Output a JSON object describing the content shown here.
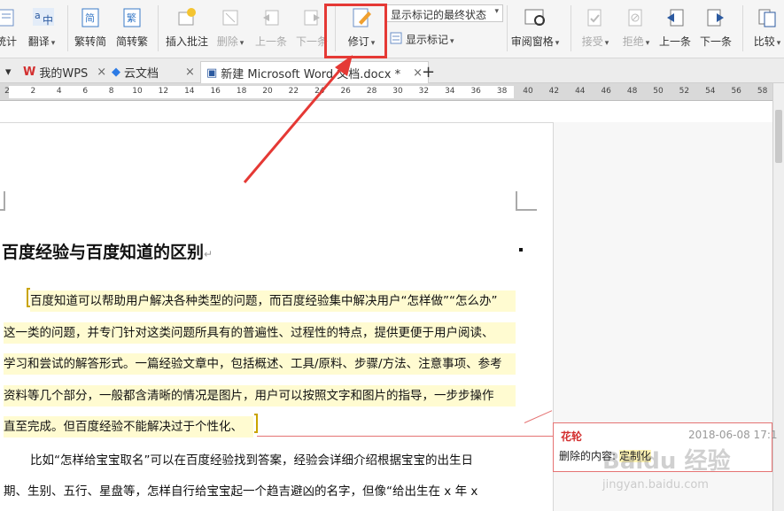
{
  "toolbar": {
    "buttons": [
      {
        "label": "统计",
        "icon": "word-count-icon"
      },
      {
        "label": "翻译",
        "icon": "translate-icon"
      },
      {
        "label": "繁转简",
        "icon": "traditional-to-simplified-icon"
      },
      {
        "label": "简转繁",
        "icon": "simplified-to-traditional-icon"
      },
      {
        "label": "插入批注",
        "icon": "insert-comment-icon"
      },
      {
        "label": "删除",
        "icon": "delete-comment-icon"
      },
      {
        "label": "上一条",
        "icon": "previous-comment-icon"
      },
      {
        "label": "下一条",
        "icon": "next-comment-icon"
      },
      {
        "label": "修订",
        "icon": "track-changes-icon"
      },
      {
        "label": "显示标记",
        "icon": "show-markup-icon"
      },
      {
        "label": "审阅窗格",
        "icon": "review-pane-icon"
      },
      {
        "label": "接受",
        "icon": "accept-icon"
      },
      {
        "label": "拒绝",
        "icon": "reject-icon"
      },
      {
        "label": "上一条",
        "icon": "previous-change-icon"
      },
      {
        "label": "下一条",
        "icon": "next-change-icon"
      },
      {
        "label": "比较",
        "icon": "compare-icon"
      }
    ],
    "display_mode_select": "显示标记的最终状态"
  },
  "tabs": [
    {
      "label": "我的WPS",
      "icon": "wps-logo-icon"
    },
    {
      "label": "云文档",
      "icon": "cloud-doc-icon"
    },
    {
      "label": "新建 Microsoft Word 文档.docx *",
      "icon": "word-doc-icon"
    }
  ],
  "new_tab_label": "+",
  "ruler_ticks": [
    "2",
    "2",
    "4",
    "6",
    "8",
    "10",
    "12",
    "14",
    "16",
    "18",
    "20",
    "22",
    "24",
    "26",
    "28",
    "30",
    "32",
    "34",
    "36",
    "38",
    "40",
    "42",
    "44",
    "46",
    "48",
    "50",
    "52",
    "54",
    "56",
    "58"
  ],
  "document": {
    "title": "百度经验与百度知道的区别",
    "lines": [
      "百度知道可以帮助用户解决各种类型的问题，而百度经验集中解决用户“怎样做”“怎么办”",
      "这一类的问题，并专门针对这类问题所具有的普遍性、过程性的特点，提供更便于用户阅读、",
      "学习和尝试的解答形式。一篇经验文章中，包括概述、工具/原料、步骤/方法、注意事项、参考",
      "资料等几个部分，一般都含清晰的情况是图片，用户可以按照文字和图片的指导，一步步操作",
      "直至完成。但百度经验不能解决过于个性化、"
    ],
    "lines_after": [
      "比如“怎样给宝宝取名”可以在百度经验找到答案，经验会详细介绍根据宝宝的出生日",
      "期、生别、五行、星盘等，怎样自行给宝宝起一个趋吉避凶的名字，但像“给出生在 x 年 x"
    ]
  },
  "comment": {
    "author": "花轮",
    "date": "2018-06-08 17:1",
    "body_label": "删除的内容:",
    "body_value": "定制化"
  },
  "watermark": {
    "main": "Baidu 经验",
    "sub": "jingyan.baidu.com"
  },
  "colors": {
    "highlight_box": "#e53935",
    "annotation_arrow": "#e53935",
    "revision_highlight": "#fffbd1",
    "comment_border": "#e57373",
    "comment_author": "#d32f2f"
  }
}
